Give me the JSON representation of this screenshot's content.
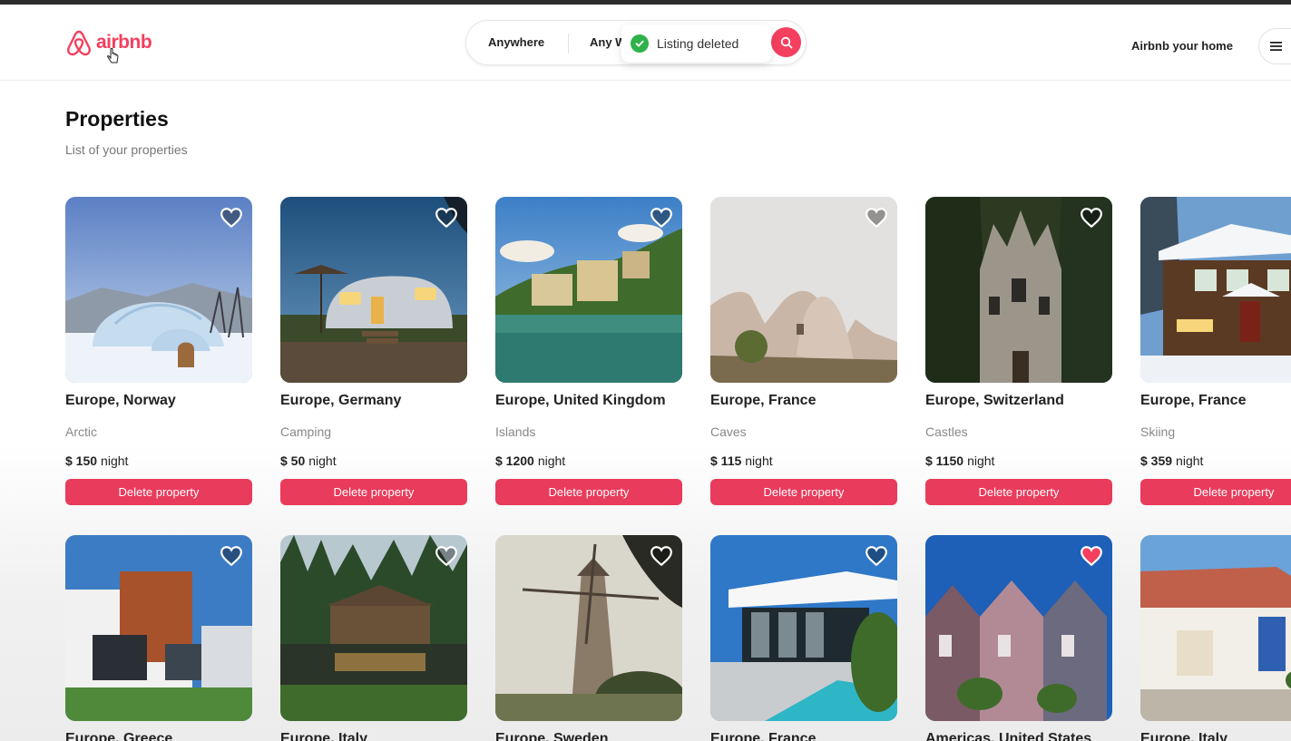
{
  "header": {
    "logo_text": "airbnb",
    "search": {
      "location": "Anywhere",
      "week": "Any W"
    },
    "host_link": "Airbnb your home",
    "toast": "Listing deleted"
  },
  "page": {
    "title": "Properties",
    "subtitle": "List of your properties"
  },
  "listings_row1": [
    {
      "location": "Europe, Norway",
      "category": "Arctic",
      "price": "$ 150",
      "per": "night",
      "delete_label": "Delete property",
      "favorited": false
    },
    {
      "location": "Europe, Germany",
      "category": "Camping",
      "price": "$ 50",
      "per": "night",
      "delete_label": "Delete property",
      "favorited": false
    },
    {
      "location": "Europe, United Kingdom",
      "category": "Islands",
      "price": "$ 1200",
      "per": "night",
      "delete_label": "Delete property",
      "favorited": false
    },
    {
      "location": "Europe, France",
      "category": "Caves",
      "price": "$ 115",
      "per": "night",
      "delete_label": "Delete property",
      "favorited": false
    },
    {
      "location": "Europe, Switzerland",
      "category": "Castles",
      "price": "$ 1150",
      "per": "night",
      "delete_label": "Delete property",
      "favorited": false
    },
    {
      "location": "Europe, France",
      "category": "Skiing",
      "price": "$ 359",
      "per": "night",
      "delete_label": "Delete property",
      "favorited": false
    }
  ],
  "listings_row2": [
    {
      "location": "Europe, Greece",
      "favorited": false
    },
    {
      "location": "Europe, Italy",
      "favorited": false
    },
    {
      "location": "Europe, Sweden",
      "favorited": false
    },
    {
      "location": "Europe, France",
      "favorited": false
    },
    {
      "location": "Americas, United States",
      "favorited": true
    },
    {
      "location": "Europe, Italy",
      "favorited": false
    }
  ],
  "colors": {
    "brand": "#f43f5e",
    "delete_button": "#e93b5c",
    "toast_success": "#2fb14b"
  }
}
